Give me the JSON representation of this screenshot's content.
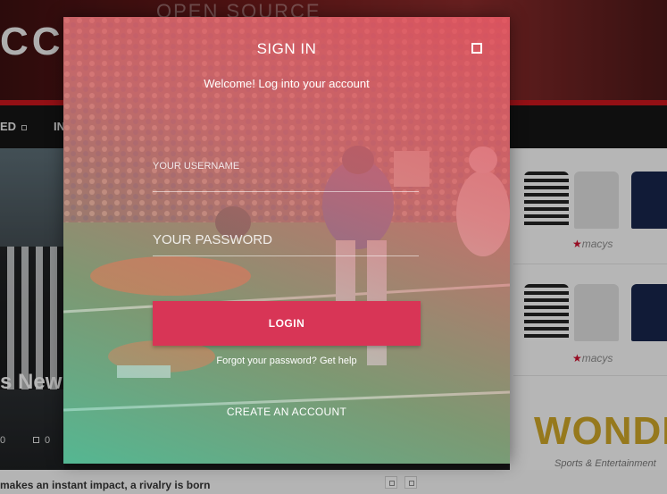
{
  "background": {
    "logo": "CCE",
    "tagline": "OPEN SOURCE",
    "nav": [
      {
        "label": "ED"
      },
      {
        "label": "IN"
      }
    ],
    "feature_title": "s New I",
    "feature_meta": [
      "0",
      "0"
    ],
    "bottom_text": "makes an instant impact, a rivalry is born",
    "ads": {
      "brand": "macys",
      "sponsor": "WONDE",
      "sponsor_sub": "Sports & Entertainment"
    }
  },
  "modal": {
    "title": "SIGN IN",
    "subtitle": "Welcome! Log into your account",
    "username_placeholder": "YOUR USERNAME",
    "password_placeholder": "YOUR PASSWORD",
    "login_label": "LOGIN",
    "forgot_label": "Forgot your password? Get help",
    "create_label": "CREATE AN ACCOUNT"
  },
  "colors": {
    "accent": "#d83556",
    "tint_top": "#e2535f",
    "tint_bottom": "#50c8aa"
  },
  "icons": {
    "close": "close-icon"
  }
}
